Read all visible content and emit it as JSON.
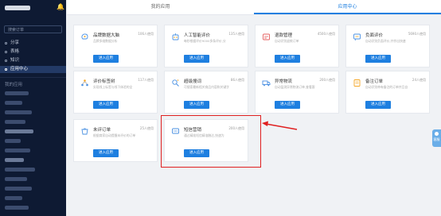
{
  "tabs": {
    "my_apps": "我的应用",
    "app_center": "应用中心"
  },
  "sidebar": {
    "search_placeholder": "搜索订单",
    "items": [
      {
        "label": "分享"
      },
      {
        "label": "表格"
      },
      {
        "label": "知识"
      },
      {
        "label": "应用中心"
      }
    ],
    "section_label": "我的应用"
  },
  "apps": [
    {
      "title": "品牌数据大脑",
      "count": "106人使用",
      "desc": "品牌多维数据分析",
      "button": "进入应用",
      "icon": "brain-icon",
      "color": "#4a90e2"
    },
    {
      "title": "人工智能评价",
      "count": "135人使用",
      "desc": "每秒根据评价9000多条评价,分",
      "button": "进入应用",
      "icon": "ai-icon",
      "color": "#f5a623"
    },
    {
      "title": "退款管理",
      "count": "4500人使用",
      "desc": "自动识别退款订单",
      "button": "进入应用",
      "icon": "refund-icon",
      "color": "#e55c5c"
    },
    {
      "title": "负面评价",
      "count": "5690人使用",
      "desc": "自动识别负面评价,并作出快速",
      "button": "进入应用",
      "icon": "negative-review-icon",
      "color": "#4a90e2"
    },
    {
      "title": "评价标签树",
      "count": "117人使用",
      "desc": "实现线上标签与线下体验的全",
      "button": "进入应用",
      "icon": "tag-tree-icon",
      "color": "#f5a623"
    },
    {
      "title": "超级搜词",
      "count": "86人使用",
      "desc": "可搜索最新相关商品内容和关键字",
      "button": "进入应用",
      "icon": "search-words-icon",
      "color": "#4a90e2"
    },
    {
      "title": "异常物流",
      "count": "200人使用",
      "desc": "自动监测异常物流订单,查看客",
      "button": "进入应用",
      "icon": "logistics-icon",
      "color": "#4a90e2"
    },
    {
      "title": "备注订单",
      "count": "24人使用",
      "desc": "自动识别带有备注的订单并且自",
      "button": "进入应用",
      "icon": "note-order-icon",
      "color": "#f5a623"
    },
    {
      "title": "未评订单",
      "count": "25人使用",
      "desc": "根据商家自动提醒未评价的订单",
      "button": "进入应用",
      "icon": "unreviewed-icon",
      "color": "#4a90e2"
    },
    {
      "title": "短信营销",
      "count": "200人使用",
      "desc": "通过精准短信精准触达,快速为",
      "button": "进入应用",
      "icon": "sms-icon",
      "color": "#4a90e2"
    }
  ],
  "side_widget": {
    "label": "客服"
  }
}
